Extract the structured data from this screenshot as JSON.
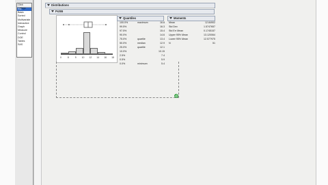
{
  "sidebar": {
    "header": "Click Catego",
    "items": [
      "Eta",
      "Basic",
      "Sorted",
      "Multivariate",
      "Interactive",
      "Graph",
      "Measure",
      "Control",
      "DOE",
      "Tables",
      "SAS"
    ],
    "selected_index": 0
  },
  "report": {
    "title": "Distributions",
    "variable": "Pct65"
  },
  "histogram": {
    "x_ticks": [
      "0",
      "8",
      "9",
      "10",
      "12",
      "14",
      "16",
      "18"
    ],
    "bar_heights": [
      0.05,
      0.12,
      0.28,
      1.0,
      0.28,
      0.1,
      0.03
    ]
  },
  "quantiles": {
    "title": "Quantiles",
    "rows": [
      {
        "pct": "100.0%",
        "label": "maximum",
        "value": "16.8"
      },
      {
        "pct": "99.5%",
        "label": "",
        "value": "16.3"
      },
      {
        "pct": "97.5%",
        "label": "",
        "value": "15.4"
      },
      {
        "pct": "90.0%",
        "label": "",
        "value": "14.6"
      },
      {
        "pct": "75.0%",
        "label": "quartile",
        "value": "13.4"
      },
      {
        "pct": "50.0%",
        "label": "median",
        "value": "12.9"
      },
      {
        "pct": "25.0%",
        "label": "quartile",
        "value": "12.1"
      },
      {
        "pct": "10.0%",
        "label": "",
        "value": "10.15"
      },
      {
        "pct": "2.5%",
        "label": "",
        "value": "7.4"
      },
      {
        "pct": "0.5%",
        "label": "",
        "value": "5.9"
      },
      {
        "pct": "0.0%",
        "label": "minimum",
        "value": "5.4"
      }
    ]
  },
  "moments": {
    "title": "Moments",
    "rows": [
      {
        "label": "Mean",
        "value": "12.84902"
      },
      {
        "label": "Std Dev",
        "value": "1.5747657"
      },
      {
        "label": "Std Err Mean",
        "value": "0.1745157"
      },
      {
        "label": "Upper 95% Mean",
        "value": "13.120064"
      },
      {
        "label": "Lower 95% Mean",
        "value": "12.577975"
      },
      {
        "label": "N",
        "value": "51"
      }
    ]
  },
  "colors": {
    "selection": "#3169c6",
    "resize_handle": "#2e9e3a"
  }
}
